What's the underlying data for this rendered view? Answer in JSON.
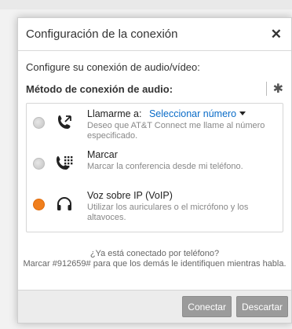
{
  "dialog": {
    "title": "Configuración de la conexión",
    "close_glyph": "✕",
    "intro": "Configure su conexión de audio/vídeo:",
    "method_title": "Método de conexión de audio:",
    "settings_glyph": "✱"
  },
  "options": [
    {
      "icon": "phone-callback-icon",
      "title": "Llamarme a:",
      "select_label": "Seleccionar número",
      "subtitle": "Deseo que AT&T Connect me llame al número especificado.",
      "selected": false
    },
    {
      "icon": "phone-dialpad-icon",
      "title": "Marcar",
      "subtitle": "Marcar la conferencia desde mi teléfono.",
      "selected": false
    },
    {
      "icon": "headset-icon",
      "title": "Voz sobre IP (VoIP)",
      "subtitle": "Utilizar los auriculares o el micrófono y los altavoces.",
      "selected": true
    }
  ],
  "footer": {
    "line1": "¿Ya está conectado por teléfono?",
    "line2": "Marcar #912659# para que los demás le identifiquen mientras habla."
  },
  "buttons": {
    "connect": "Conectar",
    "dismiss": "Descartar"
  },
  "colors": {
    "accent": "#f07f1d",
    "link": "#0a6cc8"
  }
}
